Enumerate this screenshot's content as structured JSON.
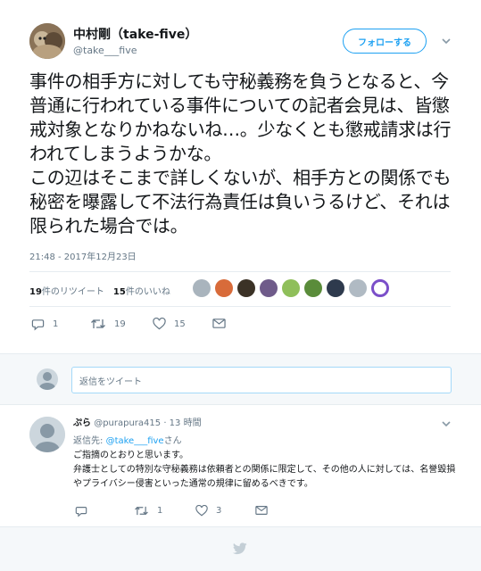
{
  "tweet": {
    "display_name": "中村剛（take-five）",
    "handle": "@take___five",
    "follow_label": "フォローする",
    "text": "事件の相手方に対しても守秘義務を負うとなると、今普通に行われている事件についての記者会見は、皆懲戒対象となりかねないね…。少なくとも懲戒請求は行われてしまうようかな。\nこの辺はそこまで詳しくないが、相手方との関係でも秘密を曝露して不法行為責任は負いうるけど、それは限られた場合では。",
    "timestamp": "21:48 - 2017年12月23日",
    "retweet_count": "19",
    "retweet_label": "件のリツイート",
    "like_count": "15",
    "like_label": "件のいいね",
    "actions": {
      "reply_count": "1",
      "retweet_count": "19",
      "like_count": "15"
    },
    "liker_colors": [
      "#a9b4bd",
      "#d86b3a",
      "#3b3226",
      "#6f5b8a",
      "#8fbf5a",
      "#5a8c3a",
      "#2e3a4d",
      "#b0bac3",
      "#7b4fc9"
    ]
  },
  "reply_bar": {
    "placeholder": "返信をツイート"
  },
  "reply": {
    "name": "ぷら",
    "handle": "@purapura415",
    "time": "· 13 時間",
    "reply_to_prefix": "返信先: ",
    "reply_to_handle": "@take___five",
    "reply_to_suffix": "さん",
    "line1": "ご指摘のとおりと思います。",
    "line2": "弁護士としての特別な守秘義務は依頼者との関係に限定して、その他の人に対しては、名誉毀損やプライバシー侵害といった通常の規律に留めるべきです。",
    "actions": {
      "reply_count": "",
      "retweet_count": "1",
      "like_count": "3"
    }
  },
  "colors": {
    "accent": "#1da1f2",
    "muted": "#657786",
    "text": "#14171a",
    "divider": "#e6ecf0"
  }
}
